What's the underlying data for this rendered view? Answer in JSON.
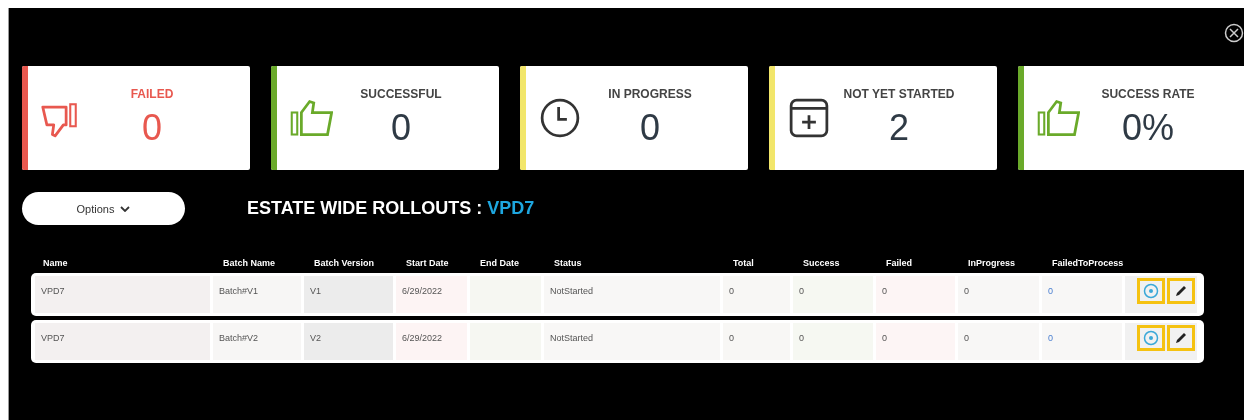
{
  "cards": [
    {
      "kind": "failed",
      "label": "FAILED",
      "value": "0",
      "color": "#e8584f"
    },
    {
      "kind": "thumb",
      "label": "SUCCESSFUL",
      "value": "0",
      "color": "#6aaa2a"
    },
    {
      "kind": "clock",
      "label": "IN PROGRESS",
      "value": "0",
      "color": "#f2e66a"
    },
    {
      "kind": "window",
      "label": "NOT YET STARTED",
      "value": "2",
      "color": "#f2e66a"
    },
    {
      "kind": "thumb",
      "label": "SUCCESS RATE",
      "value": "0%",
      "color": "#6aaa2a"
    }
  ],
  "options_button": {
    "label": "Options"
  },
  "heading": {
    "title": "ESTATE WIDE ROLLOUTS :",
    "highlight": "VPD7"
  },
  "table": {
    "columns": [
      "Name",
      "Batch Name",
      "Batch Version",
      "Start Date",
      "End Date",
      "Status",
      "Total",
      "Success",
      "Failed",
      "InProgress",
      "FailedToProcess"
    ],
    "rows": [
      {
        "cells": [
          "VPD7",
          "Batch#V1",
          "V1",
          "6/29/2022",
          "",
          "NotStarted",
          "0",
          "0",
          "0",
          "0",
          "0"
        ],
        "actions": [
          {
            "kind": "add",
            "highlighted": true
          },
          {
            "kind": "edit",
            "highlighted": true
          }
        ]
      },
      {
        "cells": [
          "VPD7",
          "Batch#V2",
          "V2",
          "6/29/2022",
          "",
          "NotStarted",
          "0",
          "0",
          "0",
          "0",
          "0"
        ],
        "actions": [
          {
            "kind": "add",
            "highlighted": true
          },
          {
            "kind": "edit",
            "highlighted": true
          }
        ]
      }
    ]
  }
}
